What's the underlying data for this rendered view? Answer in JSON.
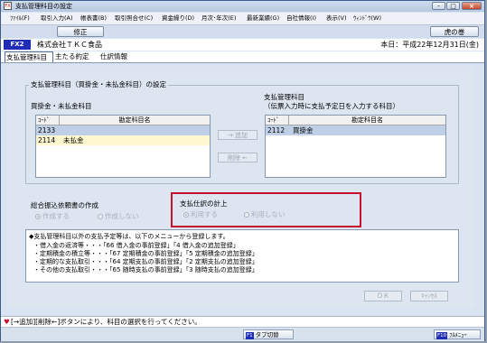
{
  "window": {
    "title": "支払管理科目の設定",
    "app_icon": "FX",
    "controls": [
      "-",
      "□",
      "×"
    ]
  },
  "menubar": {
    "items": [
      "ﾌｧｲﾙ(F)",
      "取引入力(A)",
      "帳表書(B)",
      "取引照合せ(C)",
      "資金繰り(D)",
      "月次･年次(E)",
      "最新業績(G)",
      "自社情報(I)",
      "表示(V)",
      "ｳｨﾝﾄﾞｳ(W)"
    ]
  },
  "toolbar": {
    "edit_label": "修正",
    "tora_label": "虎の巻"
  },
  "infobar": {
    "badge": "FX2",
    "company": "株式会社ＴＫＣ食品",
    "today": "本日：平成22年12月31日(金)"
  },
  "tabs": [
    "支払管理科目",
    "主たる約定",
    "仕訳情報"
  ],
  "section": {
    "title": "支払管理科目（買掛金・未払金科目）の設定"
  },
  "left_list": {
    "title": "買掛金・未払金科目",
    "col_code": "ｺｰﾄﾞ",
    "col_name": "勘定科目名",
    "rows": [
      {
        "code": "2133",
        "name": ""
      },
      {
        "code": "2114",
        "name": "未払金"
      }
    ]
  },
  "right_list": {
    "title": "支払管理科目",
    "subtitle": "（伝票入力時に支払予定日を入力する科目）",
    "col_code": "ｺｰﾄﾞ",
    "col_name": "勘定科目名",
    "rows": [
      {
        "code": "2112",
        "name": "買掛金"
      }
    ]
  },
  "buttons": {
    "add": "→ 追加",
    "delete": "削除 ←",
    "ok": "ＯＫ",
    "cancel": "ｷｬﾝｾﾙ"
  },
  "consolidated": {
    "title": "総合振込依頼書の作成",
    "opt_create": "作成する",
    "opt_nocreate": "作成しない"
  },
  "journal": {
    "title": "支払仕訳の計上",
    "opt_use": "利用する",
    "opt_nouse": "利用しない"
  },
  "notes": {
    "lines": [
      "◆支払管理科目以外の支払予定等は、以下のメニューから登録します。",
      "・借入金の返済等・・・「66 借入金の事前登録」「4 借入金の追加登録」",
      "・定期積金の積立等・・・「67 定期積金の事前登録」「5 定期積金の追加登録」",
      "・定期的な支払取引・・・「64 定期支払の事前登録」「2 定期支払の追加登録」",
      "・その他の支払取引・・・「65 随時支払の事前登録」「3 随時支払の追加登録」"
    ]
  },
  "statusbar": {
    "text": "[→追加][削除←]ボタンにより、科目の選択を行ってください。"
  },
  "fkeys": {
    "f1_num": "F1",
    "f1_label": "タブ切替",
    "f10_num": "F10",
    "f10_label": "ﾌﾙﾒﾆｭｰ"
  }
}
